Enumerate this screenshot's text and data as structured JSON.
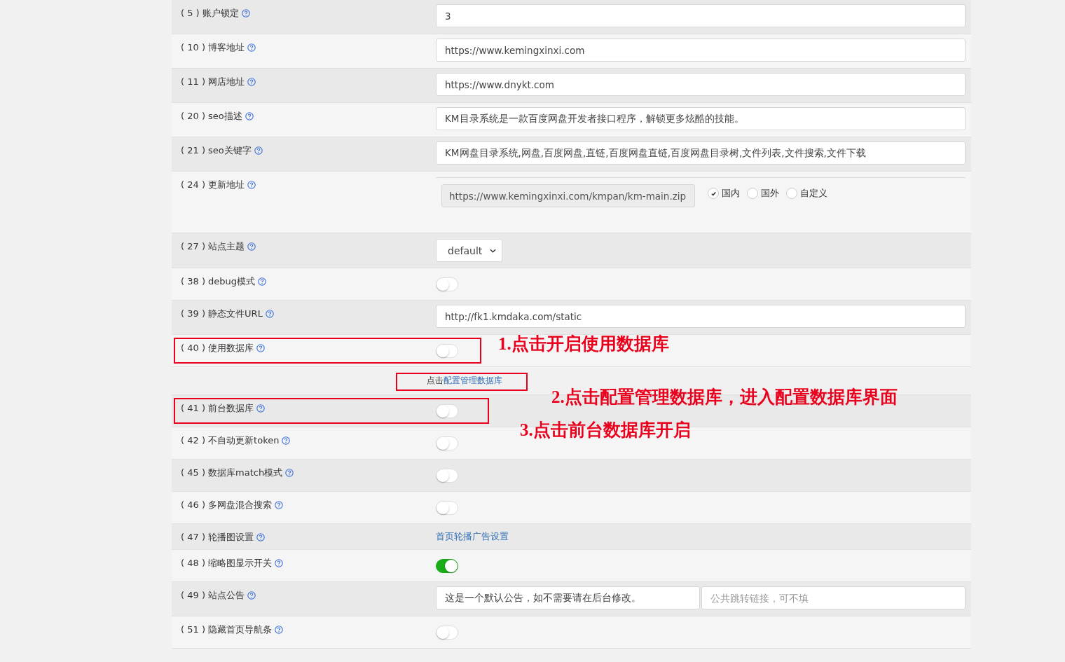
{
  "rows": [
    {
      "label": "( 5 ) 账户锁定",
      "kind": "text",
      "value": "3"
    },
    {
      "label": "( 10 ) 博客地址",
      "kind": "text",
      "value": "https://www.kemingxinxi.com"
    },
    {
      "label": "( 11 ) 网店地址",
      "kind": "text",
      "value": "https://www.dnykt.com"
    },
    {
      "label": "( 20 ) seo描述",
      "kind": "text",
      "value": "KM目录系统是一款百度网盘开发者接口程序，解锁更多炫酷的技能。"
    },
    {
      "label": "( 21 ) seo关键字",
      "kind": "text",
      "value": "KM网盘目录系统,网盘,百度网盘,直链,百度网盘直链,百度网盘目录树,文件列表,文件搜索,文件下载"
    },
    {
      "label": "( 24 ) 更新地址",
      "kind": "update",
      "value": "https://www.kemingxinxi.com/kmpan/km-main.zip",
      "options": [
        {
          "label": "国内",
          "selected": true
        },
        {
          "label": "国外",
          "selected": false
        },
        {
          "label": "自定义",
          "selected": false
        }
      ]
    },
    {
      "label": "( 27 ) 站点主题",
      "kind": "select",
      "value": "default"
    },
    {
      "label": "( 38 ) debug模式",
      "kind": "toggle",
      "on": false
    },
    {
      "label": "( 39 ) 静态文件URL",
      "kind": "text",
      "value": "http://fk1.kmdaka.com/static"
    },
    {
      "label": "( 40 ) 使用数据库",
      "kind": "toggle",
      "on": false,
      "note": {
        "prefix": "点击",
        "link": "配置管理数据库"
      }
    },
    {
      "label": "( 41 ) 前台数据库",
      "kind": "toggle",
      "on": false
    },
    {
      "label": "( 42 ) 不自动更新token",
      "kind": "toggle",
      "on": false
    },
    {
      "label": "( 45 ) 数据库match模式",
      "kind": "toggle",
      "on": false
    },
    {
      "label": "( 46 ) 多网盘混合搜索",
      "kind": "toggle",
      "on": false
    },
    {
      "label": "( 47 ) 轮播图设置",
      "kind": "link",
      "value": "首页轮播广告设置"
    },
    {
      "label": "( 48 ) 缩略图显示开关",
      "kind": "toggle",
      "on": true
    },
    {
      "label": "( 49 ) 站点公告",
      "kind": "pair",
      "value": "这是一个默认公告，如不需要请在后台修改。",
      "placeholder": "公共跳转链接，可不填"
    },
    {
      "label": "( 51 ) 隐藏首页导航条",
      "kind": "toggle",
      "on": false
    }
  ],
  "annotations": [
    {
      "text": "1.点击开启使用数据库"
    },
    {
      "text": "2.点击配置管理数据库，进入配置数据库界面"
    },
    {
      "text": "3.点击前台数据库开启"
    }
  ]
}
